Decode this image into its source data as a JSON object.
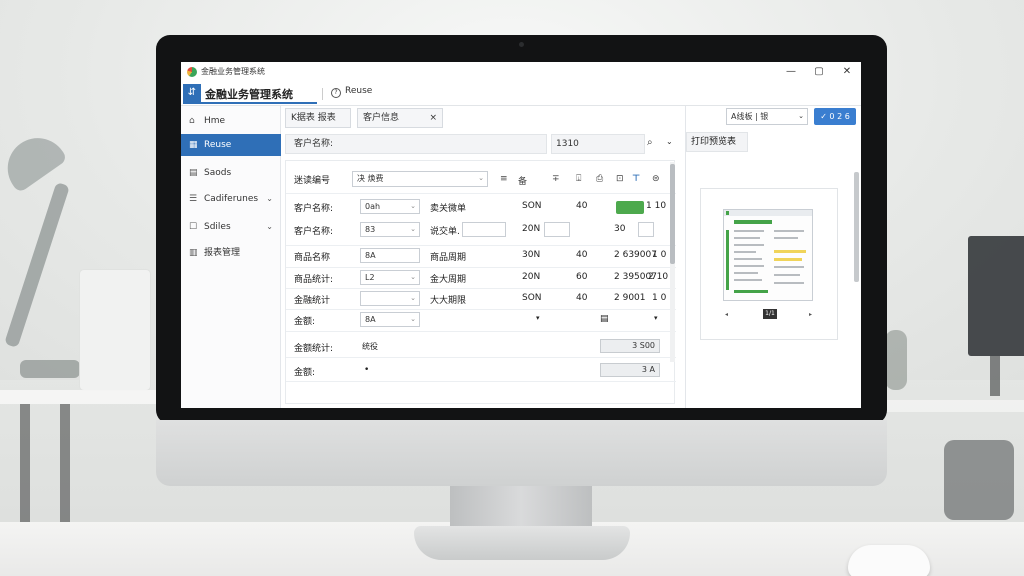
{
  "window": {
    "title": "金融业务管理系统",
    "controls": {
      "minimize": "—",
      "maximize": "▢",
      "close": "✕"
    }
  },
  "tabs": {
    "main_icon": "⇵",
    "main_label": "金融业务管理系统",
    "secondary_icon": "?",
    "secondary_label": "Reuse"
  },
  "sidebar": {
    "items": [
      {
        "icon": "home-icon",
        "glyph": "⌂",
        "label": "Hme",
        "active": false,
        "chevron": ""
      },
      {
        "icon": "grid-icon",
        "glyph": "▦",
        "label": "Reuse",
        "active": true,
        "chevron": ""
      },
      {
        "icon": "table-icon",
        "glyph": "▤",
        "label": "Saods",
        "active": false,
        "chevron": ""
      },
      {
        "icon": "category-icon",
        "glyph": "☰",
        "label": "Cadiferunes",
        "active": false,
        "chevron": "⌄"
      },
      {
        "icon": "sales-icon",
        "glyph": "☐",
        "label": "Sdiles",
        "active": false,
        "chevron": "⌄"
      },
      {
        "icon": "report-icon",
        "glyph": "▥",
        "label": "报表管理",
        "active": false,
        "chevron": ""
      }
    ]
  },
  "toolbar": {
    "crumb_1": "K据表 报表",
    "crumb_2": "客户信息",
    "crumb_2_close": "×",
    "field_label": "客户名称:",
    "field_value": "1310",
    "search_glyph": "⌕",
    "dropdown_glyph": "⌄"
  },
  "form": {
    "header_label": "迷读编号",
    "header_select": "决 焕费",
    "header_icons": [
      "≡",
      "备",
      "∓",
      "⍗",
      "⎙",
      "⊡",
      "⊤",
      "⊜"
    ],
    "rows": [
      {
        "label": "客户名称:",
        "input": "0ah",
        "mid_label": "卖关微单",
        "mid_input": "",
        "v1": "SON",
        "v2": "40",
        "v3": "",
        "v4": "1 10"
      },
      {
        "label": "客户名称:",
        "input": "83",
        "mid_label": "说交单.",
        "mid_input": "",
        "v1": "20N",
        "v2": "",
        "v3": "30",
        "v4": ""
      },
      {
        "label": "商品名称",
        "input": "8A",
        "mid_label": "商品周期",
        "mid_input": "",
        "v1": "30N",
        "v2": "40",
        "v3": "2 639007",
        "v4": "1 0"
      },
      {
        "label": "商品统计:",
        "input": "L2",
        "mid_label": "金大周期",
        "mid_input": "",
        "v1": "20N",
        "v2": "60",
        "v3": "2 395007",
        "v4": "2 10"
      },
      {
        "label": "金融统计",
        "input": "",
        "mid_label": "大大期限",
        "mid_input": "",
        "v1": "SON",
        "v2": "40",
        "v3": "2 9001",
        "v4": "1 0"
      },
      {
        "label": "金额:",
        "input": "8A",
        "mid_label": "",
        "mid_input": "",
        "v1": "▾",
        "v2": "",
        "v3": "▤",
        "v4": "▾"
      }
    ],
    "total_label": "金额统计:",
    "total_mid": "统役",
    "total_value": "3 S00",
    "amount_label": "金额:",
    "amount_mid": "•",
    "amount_value": "3 A"
  },
  "right_panel": {
    "select_value": "A线板 | 银",
    "button_label": "✓ 0 2 6",
    "title": "打印预览表",
    "page_label": "1/1",
    "prev": "◂",
    "next": "▸"
  },
  "colors": {
    "accent": "#2f6fb7",
    "button": "#3a7ed0",
    "green": "#4da94d"
  }
}
